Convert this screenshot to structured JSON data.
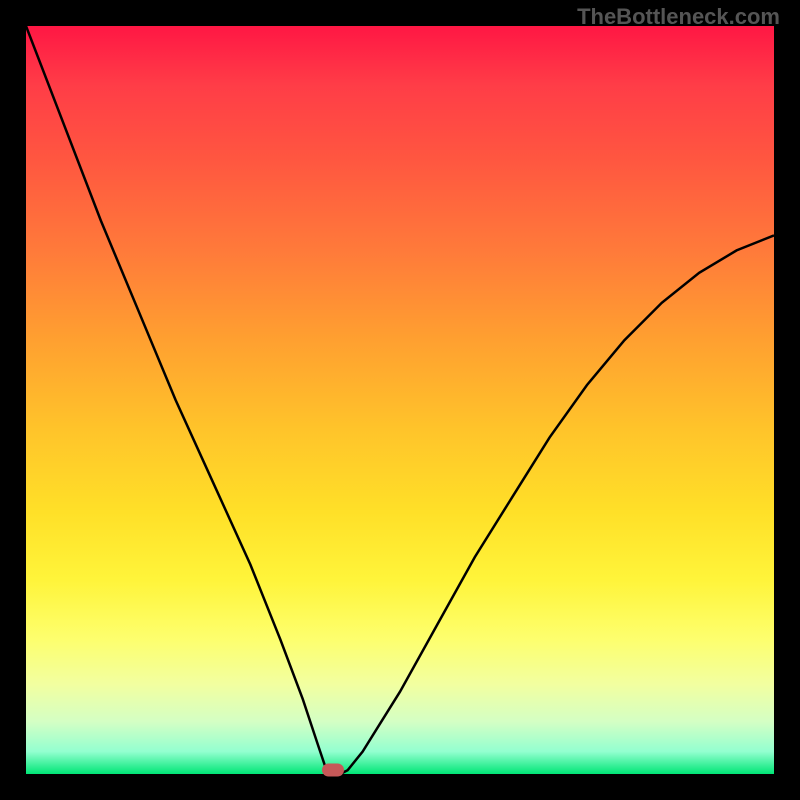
{
  "watermark": "TheBottleneck.com",
  "chart_data": {
    "type": "line",
    "title": "",
    "xlabel": "",
    "ylabel": "",
    "xlim": [
      0,
      100
    ],
    "ylim": [
      0,
      100
    ],
    "grid": false,
    "legend": false,
    "background_gradient": {
      "top": "#ff1744",
      "middle": "#ffe028",
      "bottom": "#00e676"
    },
    "series": [
      {
        "name": "bottleneck-curve",
        "x": [
          0,
          5,
          10,
          15,
          20,
          25,
          30,
          34,
          37,
          39,
          40,
          41,
          42,
          43,
          45,
          50,
          55,
          60,
          65,
          70,
          75,
          80,
          85,
          90,
          95,
          100
        ],
        "values": [
          100,
          87,
          74,
          62,
          50,
          39,
          28,
          18,
          10,
          4,
          1,
          0,
          0,
          0.5,
          3,
          11,
          20,
          29,
          37,
          45,
          52,
          58,
          63,
          67,
          70,
          72
        ],
        "color": "#000000",
        "min_x": 41,
        "min_y": 0
      }
    ],
    "marker": {
      "x": 41,
      "y": 0,
      "color": "#c65858",
      "shape": "rounded-rect"
    }
  }
}
